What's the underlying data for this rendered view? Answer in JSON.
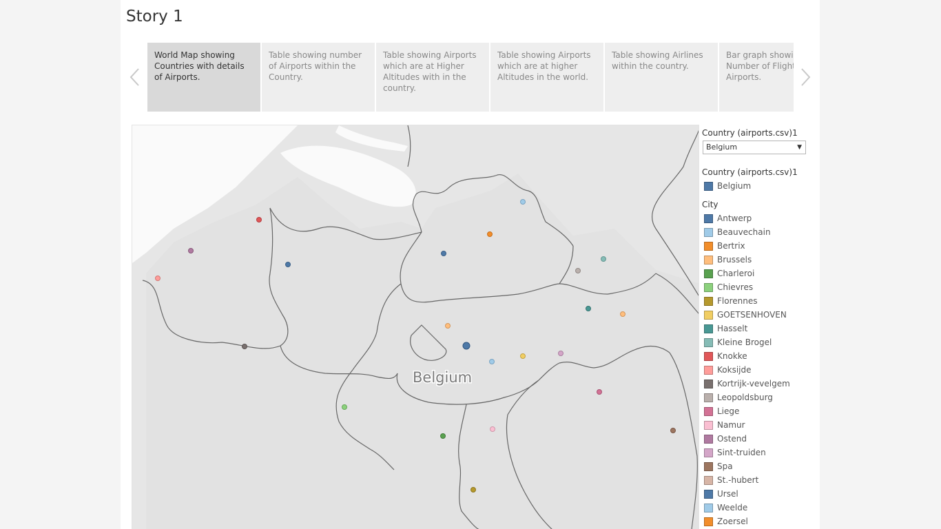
{
  "title": "Story 1",
  "story_points": [
    {
      "label": "World Map showing Countries with details of Airports.",
      "active": true
    },
    {
      "label": "Table showing number of Airports within the Country.",
      "active": false
    },
    {
      "label": "Table showing Airports which are at Higher Altitudes with in the country.",
      "active": false
    },
    {
      "label": "Table showing Airports which are at higher Altitudes in the world.",
      "active": false
    },
    {
      "label": "Table showing Airlines within the country.",
      "active": false
    },
    {
      "label": "Bar graph showing Number of Flights Airports.",
      "active": false
    }
  ],
  "map": {
    "country_label": "Belgium"
  },
  "filter": {
    "title": "Country (airports.csv)1",
    "selected": "Belgium"
  },
  "country_legend": {
    "title": "Country (airports.csv)1",
    "items": [
      {
        "label": "Belgium",
        "color": "#4e79a7"
      }
    ]
  },
  "city_legend": {
    "title": "City",
    "items": [
      {
        "label": "Antwerp",
        "color": "#4e79a7"
      },
      {
        "label": "Beauvechain",
        "color": "#a0cbe8"
      },
      {
        "label": "Bertrix",
        "color": "#f28e2b"
      },
      {
        "label": "Brussels",
        "color": "#ffbe7d"
      },
      {
        "label": "Charleroi",
        "color": "#59a14f"
      },
      {
        "label": "Chievres",
        "color": "#8cd17d"
      },
      {
        "label": "Florennes",
        "color": "#b6992d"
      },
      {
        "label": "GOETSENHOVEN",
        "color": "#f1ce63"
      },
      {
        "label": "Hasselt",
        "color": "#499894"
      },
      {
        "label": "Kleine Brogel",
        "color": "#86bcb6"
      },
      {
        "label": "Knokke",
        "color": "#e15759"
      },
      {
        "label": "Koksijde",
        "color": "#ff9d9a"
      },
      {
        "label": "Kortrijk-vevelgem",
        "color": "#79706e"
      },
      {
        "label": "Leopoldsburg",
        "color": "#bab0ac"
      },
      {
        "label": "Liege",
        "color": "#d37295"
      },
      {
        "label": "Namur",
        "color": "#fabfd2"
      },
      {
        "label": "Ostend",
        "color": "#b07aa1"
      },
      {
        "label": "Sint-truiden",
        "color": "#d4a6c8"
      },
      {
        "label": "Spa",
        "color": "#9d7660"
      },
      {
        "label": "St.-hubert",
        "color": "#d7b5a6"
      },
      {
        "label": "Ursel",
        "color": "#4e79a7"
      },
      {
        "label": "Weelde",
        "color": "#a0cbe8"
      },
      {
        "label": "Zoersel",
        "color": "#f28e2b"
      }
    ]
  },
  "icons": {
    "prev": "chevron-left-icon",
    "next": "chevron-right-icon",
    "dropdown": "caret-down-icon"
  }
}
